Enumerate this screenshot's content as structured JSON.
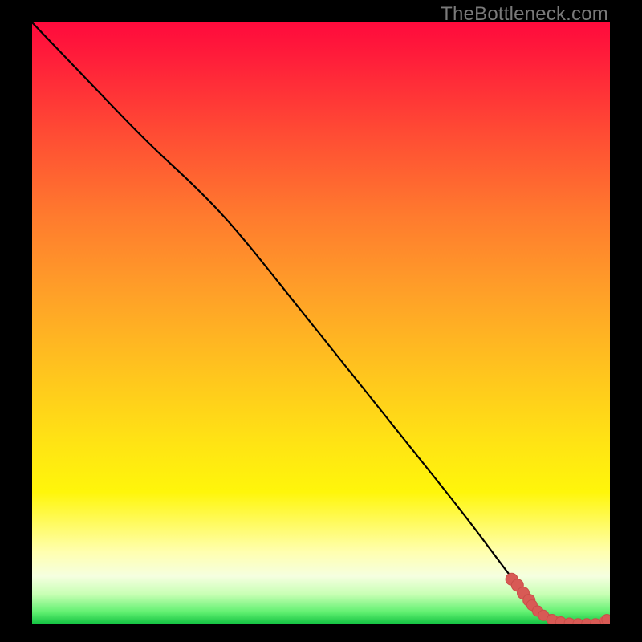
{
  "watermark": "TheBottleneck.com",
  "colors": {
    "line": "#000000",
    "marker_fill": "#d85a55",
    "marker_stroke": "#c94e49",
    "background_black": "#000000"
  },
  "chart_data": {
    "type": "line",
    "title": "",
    "xlabel": "",
    "ylabel": "",
    "xlim": [
      0,
      100
    ],
    "ylim": [
      0,
      100
    ],
    "series": [
      {
        "name": "bottleneck-curve",
        "x": [
          0,
          10,
          20,
          28,
          35,
          45,
          55,
          65,
          75,
          82,
          86,
          90,
          94,
          97,
          100
        ],
        "y": [
          100,
          90,
          80,
          73,
          66,
          54,
          42,
          30,
          18,
          9,
          4,
          1,
          0,
          0,
          1
        ]
      }
    ],
    "markers": {
      "name": "highlight-points",
      "x": [
        83,
        84,
        85,
        86,
        86.5,
        87.5,
        88.5,
        90,
        91.5,
        93,
        94.5,
        96,
        97.5,
        99.5
      ],
      "y": [
        7.5,
        6.5,
        5.2,
        4.0,
        3.2,
        2.2,
        1.5,
        0.8,
        0.4,
        0.2,
        0.1,
        0.1,
        0.1,
        0.8
      ]
    }
  }
}
